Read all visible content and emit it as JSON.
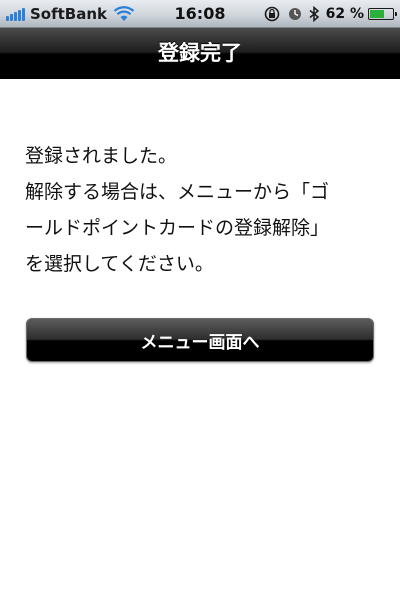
{
  "status_bar": {
    "carrier": "SoftBank",
    "time": "16:08",
    "battery_percent": "62 %",
    "battery_level": 0.62,
    "icons": [
      "signal-icon",
      "wifi-icon",
      "rotation-lock-icon",
      "alarm-icon",
      "bluetooth-icon",
      "battery-icon"
    ]
  },
  "nav": {
    "title": "登録完了"
  },
  "message": {
    "lines": [
      "登録されました。",
      "解除する場合は、メニューから「ゴ",
      "ールドポイントカードの登録解除」",
      "を選択してください。"
    ]
  },
  "menu_button": {
    "label": "メニュー画面へ"
  },
  "colors": {
    "nav_background": "#000000",
    "nav_text": "#ffffff",
    "body_text": "#111111",
    "battery_fill": "#2bb03a",
    "signal": "#2a7fd8"
  }
}
